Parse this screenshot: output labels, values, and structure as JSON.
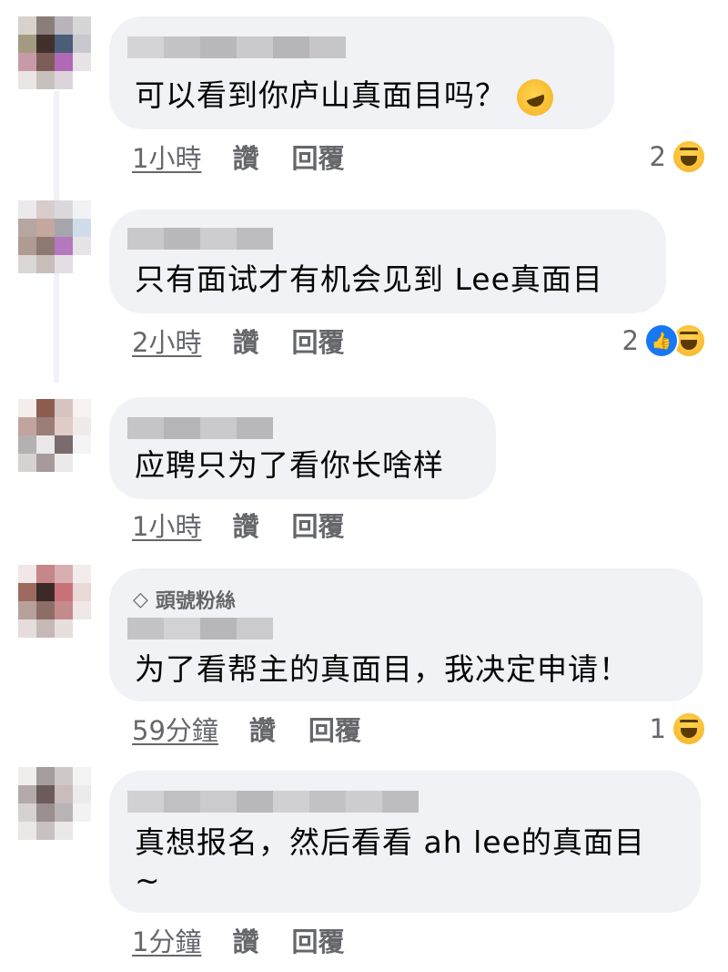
{
  "comments": [
    {
      "text": "可以看到你庐山真面目吗？",
      "emoji": "rofl-emoji",
      "time": "1小時",
      "like_label": "讚",
      "reply_label": "回覆",
      "reaction_count": "2",
      "reactions": [
        "haha"
      ]
    },
    {
      "text": "只有面试才有机会见到 Lee真面目",
      "time": "2小時",
      "like_label": "讚",
      "reply_label": "回覆",
      "reaction_count": "2",
      "reactions": [
        "like",
        "haha"
      ]
    },
    {
      "text": "应聘只为了看你长啥样",
      "time": "1小時",
      "like_label": "讚",
      "reply_label": "回覆"
    },
    {
      "badge_icon": "diamond-icon",
      "badge": "頭號粉絲",
      "text": "为了看帮主的真面目，我决定申请！",
      "time": "59分鐘",
      "like_label": "讚",
      "reply_label": "回覆",
      "reaction_count": "1",
      "reactions": [
        "haha"
      ]
    },
    {
      "text_line1": "真想报名，然后看看 ah lee的真面目",
      "text_line2": "~",
      "time": "1分鐘",
      "like_label": "讚",
      "reply_label": "回覆"
    }
  ],
  "colors": {
    "bubble": "#f0f2f5",
    "meta_text": "#65676b",
    "like_blue": "#1877f2",
    "haha_yellow": "#f7b125"
  }
}
